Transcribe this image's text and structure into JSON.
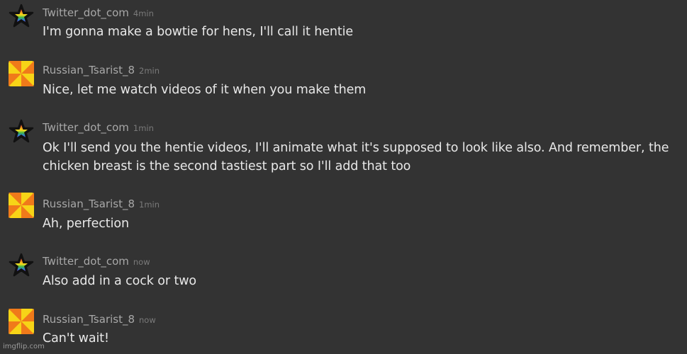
{
  "messages": [
    {
      "author": "Twitter_dot_com",
      "time": "4min",
      "avatar_icon": "rainbow-star-icon",
      "text": "I'm gonna make a bowtie for hens, I'll call it hentie"
    },
    {
      "author": "Russian_Tsarist_8",
      "time": "2min",
      "avatar_icon": "pinwheel-icon",
      "text": "Nice, let me watch videos of it when you make them"
    },
    {
      "author": "Twitter_dot_com",
      "time": "1min",
      "avatar_icon": "rainbow-star-icon",
      "text": "Ok I'll send you the hentie videos, I'll animate what it's supposed to look like also. And remember, the chicken breast is the second tastiest part so I'll add that too"
    },
    {
      "author": "Russian_Tsarist_8",
      "time": "1min",
      "avatar_icon": "pinwheel-icon",
      "text": "Ah, perfection"
    },
    {
      "author": "Twitter_dot_com",
      "time": "now",
      "avatar_icon": "rainbow-star-icon",
      "text": "Also add in a cock or two"
    },
    {
      "author": "Russian_Tsarist_8",
      "time": "now",
      "avatar_icon": "pinwheel-icon",
      "text": "Can't wait!"
    }
  ],
  "watermark": "imgflip.com",
  "colors": {
    "background": "#333333",
    "username": "#a8a8a8",
    "timestamp": "#7a7a7a",
    "message_text": "#e8e8e8",
    "pinwheel_yellow": "#f7d417",
    "pinwheel_orange": "#f07a1a"
  }
}
